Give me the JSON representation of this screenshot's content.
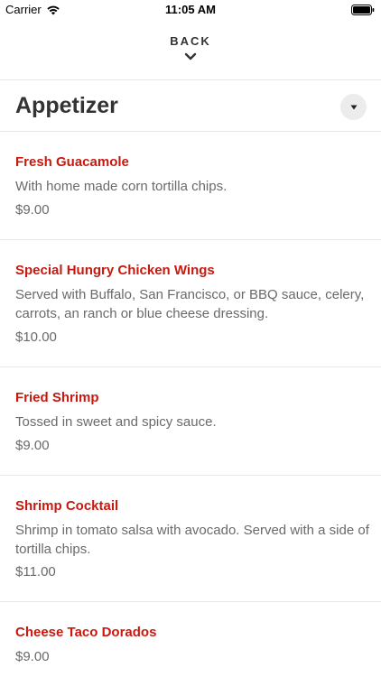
{
  "status_bar": {
    "carrier": "Carrier",
    "time": "11:05 AM"
  },
  "nav": {
    "back_label": "BACK"
  },
  "section": {
    "title": "Appetizer"
  },
  "items": [
    {
      "name": "Fresh Guacamole",
      "description": "With home made corn tortilla chips.",
      "price": "$9.00"
    },
    {
      "name": "Special Hungry Chicken Wings",
      "description": "Served with Buffalo, San Francisco, or BBQ sauce, celery, carrots, an ranch or blue cheese dressing.",
      "price": "$10.00"
    },
    {
      "name": "Fried Shrimp",
      "description": "Tossed in sweet and spicy sauce.",
      "price": "$9.00"
    },
    {
      "name": "Shrimp Cocktail",
      "description": "Shrimp in tomato salsa with avocado. Served with a side of tortilla chips.",
      "price": "$11.00"
    },
    {
      "name": "Cheese Taco Dorados",
      "price": "$9.00"
    }
  ],
  "colors": {
    "item_name": "#c8190f",
    "body_text": "#6a6a6a",
    "heading_text": "#333333",
    "divider": "#e6e6e6",
    "collapse_button_bg": "#ececec"
  },
  "icons": {
    "wifi": "wifi-icon",
    "battery": "battery-icon",
    "back": "chevron-down-icon",
    "collapse": "caret-down-icon"
  }
}
